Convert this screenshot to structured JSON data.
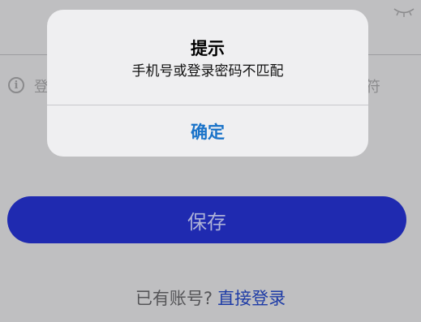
{
  "background_form": {
    "hint_text_start": "登",
    "hint_text_end": "符",
    "save_label": "保存",
    "login_question": "已有账号?",
    "login_link": "直接登录"
  },
  "alert": {
    "title": "提示",
    "message": "手机号或登录密码不匹配",
    "confirm_label": "确定"
  },
  "colors": {
    "save_button": "#1f2ab0",
    "link": "#1d3ba6",
    "alert_confirm": "#1a73c9"
  },
  "icons": [
    "eye-closed-icon",
    "info-icon"
  ]
}
